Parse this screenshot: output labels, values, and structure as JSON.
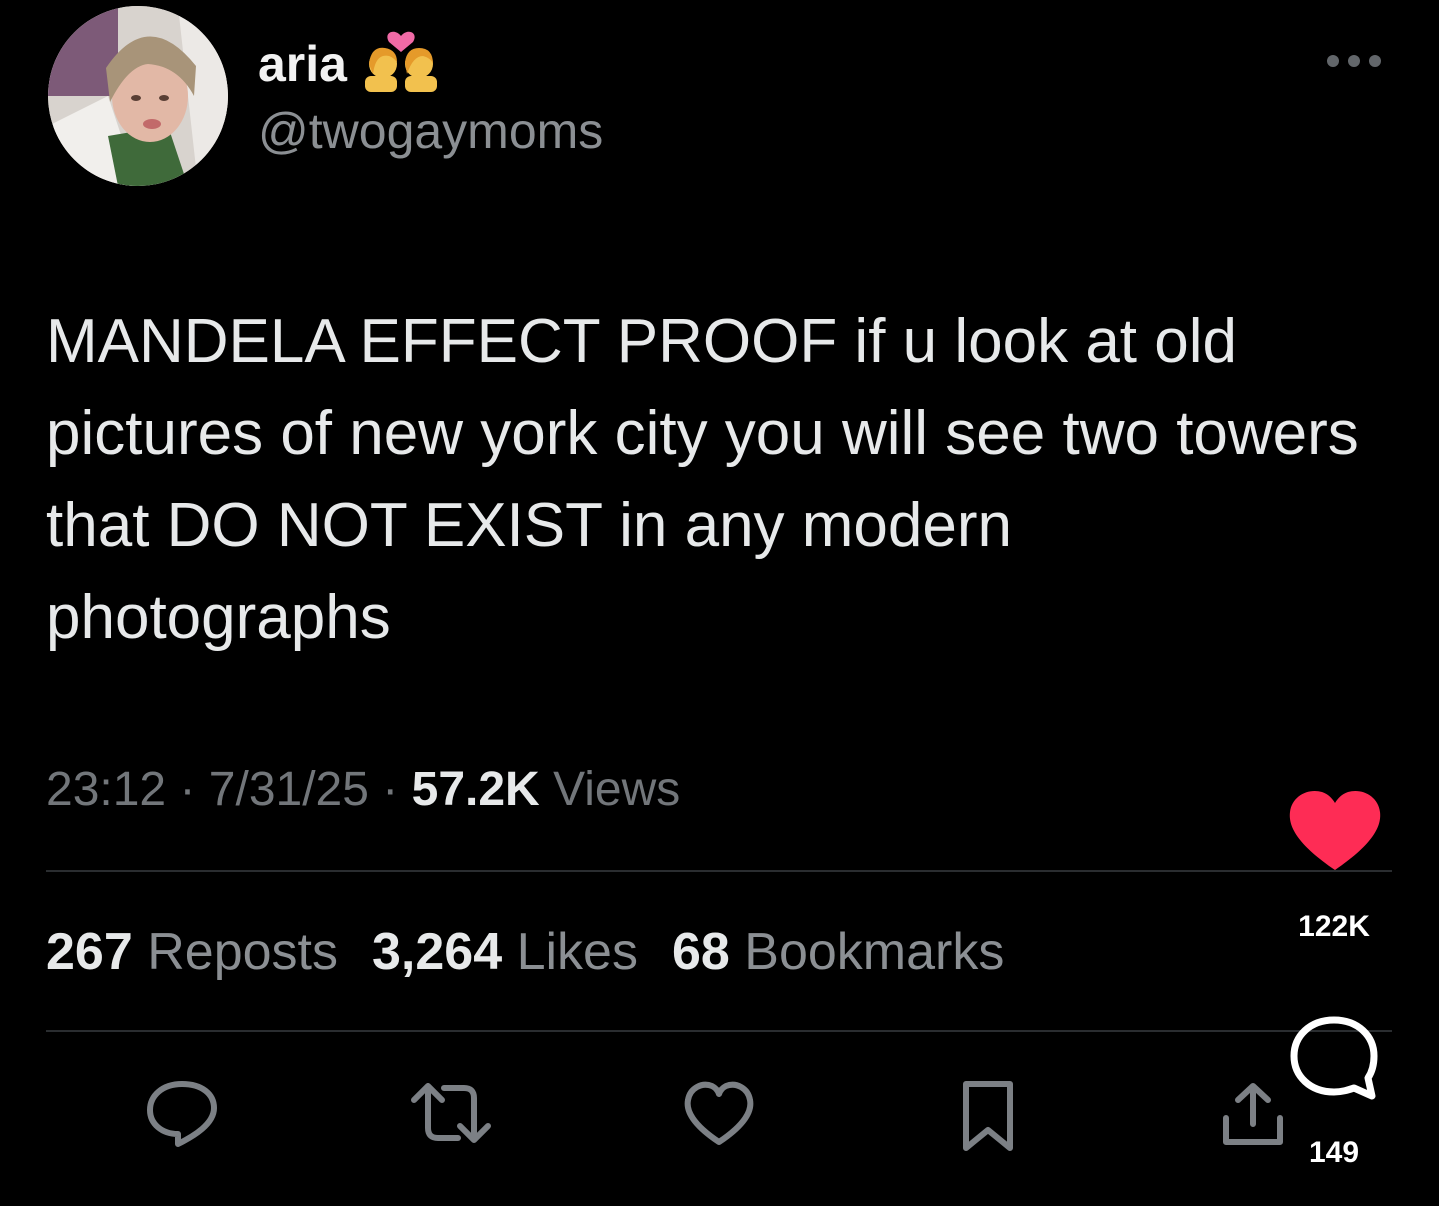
{
  "author": {
    "display_name": "aria",
    "name_emoji": "couple-with-heart-two-women",
    "handle": "@twogaymoms"
  },
  "tweet": {
    "text": "MANDELA EFFECT PROOF if u look at old pictures of new york city you will see two towers that DO NOT EXIST in any modern photographs",
    "time": "23:12",
    "date": "7/31/25",
    "views_count": "57.2K",
    "views_label": "Views",
    "separator": "·"
  },
  "stats": {
    "reposts_count": "267",
    "reposts_label": "Reposts",
    "likes_count": "3,264",
    "likes_label": "Likes",
    "bookmarks_count": "68",
    "bookmarks_label": "Bookmarks"
  },
  "actions": [
    "reply-icon",
    "repost-icon",
    "like-icon",
    "bookmark-icon",
    "share-icon"
  ],
  "overlay": {
    "like_count": "122K",
    "comment_count": "149",
    "heart_color": "#fe2c55"
  },
  "colors": {
    "background": "#000000",
    "text": "#e7e9ea",
    "muted": "#72767a"
  }
}
